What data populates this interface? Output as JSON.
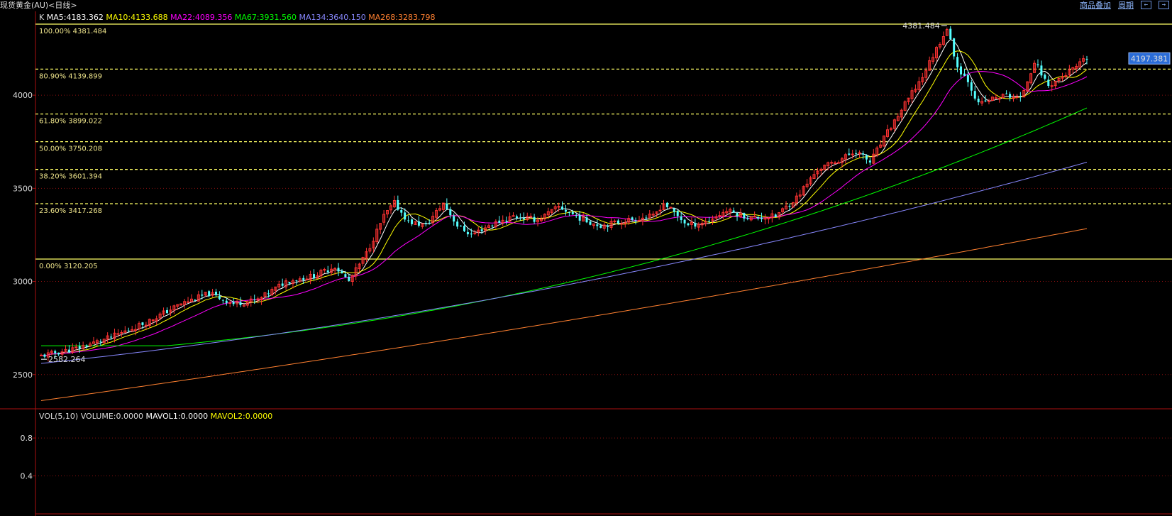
{
  "window": {
    "title": "现货黄金(AU)<日线>",
    "links": [
      "商品叠加",
      "周期"
    ],
    "nav_buttons": [
      "←",
      "→"
    ]
  },
  "indicator_legend": {
    "prefix": "K",
    "items": [
      {
        "text": "MA5:4183.362",
        "color": "#ffffff"
      },
      {
        "text": "MA10:4133.688",
        "color": "#ffff00"
      },
      {
        "text": "MA22:4089.356",
        "color": "#ff00ff"
      },
      {
        "text": "MA67:3931.560",
        "color": "#00ff00"
      },
      {
        "text": "MA134:3640.150",
        "color": "#8888ff"
      },
      {
        "text": "MA268:3283.798",
        "color": "#ff8030"
      }
    ]
  },
  "volume_legend": {
    "items": [
      {
        "text": "VOL(5,10)",
        "color": "#dddddd"
      },
      {
        "text": "VOLUME:0.0000",
        "color": "#dddddd"
      },
      {
        "text": "MAVOL1:0.0000",
        "color": "#ffffff"
      },
      {
        "text": "MAVOL2:0.0000",
        "color": "#ffff00"
      }
    ]
  },
  "chart_data": {
    "type": "candlestick",
    "title": "现货黄金(AU)<日线>",
    "ylim": [
      2320,
      4450
    ],
    "y_ticks": [
      "2500",
      "3000",
      "3500",
      "4000"
    ],
    "y_tick_values": [
      2500,
      3000,
      3500,
      4000
    ],
    "volume_ylim": [
      0,
      1.1
    ],
    "volume_ticks": [
      "0.4",
      "0.8"
    ],
    "volume_tick_values": [
      0.4,
      0.8
    ],
    "last_price_label": "4197.381",
    "last_price": 4197.381,
    "high_label": "4381.484",
    "high": 4381.484,
    "low_label": "2582.264",
    "low": 2582.264,
    "fibonacci_levels": [
      {
        "label": "100.00% 4381.484",
        "value": 4381.484,
        "style": "solid"
      },
      {
        "label": "80.90% 4139.899",
        "value": 4139.899,
        "style": "dashed"
      },
      {
        "label": "61.80% 3899.022",
        "value": 3899.022,
        "style": "dashed"
      },
      {
        "label": "50.00% 3750.208",
        "value": 3750.208,
        "style": "dashed"
      },
      {
        "label": "38.20% 3601.394",
        "value": 3601.394,
        "style": "dashed"
      },
      {
        "label": "23.60% 3417.268",
        "value": 3417.268,
        "style": "dashed"
      },
      {
        "label": "0.00% 3120.205",
        "value": 3120.205,
        "style": "solid"
      }
    ],
    "close_path": [
      [
        0,
        2600
      ],
      [
        10,
        2640
      ],
      [
        20,
        2700
      ],
      [
        30,
        2780
      ],
      [
        40,
        2880
      ],
      [
        48,
        2935
      ],
      [
        55,
        2880
      ],
      [
        62,
        2900
      ],
      [
        70,
        3000
      ],
      [
        78,
        3030
      ],
      [
        84,
        3080
      ],
      [
        88,
        3000
      ],
      [
        93,
        3150
      ],
      [
        98,
        3350
      ],
      [
        101,
        3420
      ],
      [
        105,
        3320
      ],
      [
        110,
        3300
      ],
      [
        115,
        3420
      ],
      [
        119,
        3300
      ],
      [
        123,
        3250
      ],
      [
        128,
        3300
      ],
      [
        135,
        3350
      ],
      [
        142,
        3330
      ],
      [
        148,
        3400
      ],
      [
        155,
        3330
      ],
      [
        160,
        3300
      ],
      [
        168,
        3330
      ],
      [
        175,
        3350
      ],
      [
        178,
        3420
      ],
      [
        185,
        3300
      ],
      [
        190,
        3320
      ],
      [
        196,
        3380
      ],
      [
        203,
        3340
      ],
      [
        210,
        3350
      ],
      [
        216,
        3450
      ],
      [
        222,
        3600
      ],
      [
        228,
        3650
      ],
      [
        233,
        3700
      ],
      [
        237,
        3640
      ],
      [
        242,
        3800
      ],
      [
        247,
        3950
      ],
      [
        252,
        4100
      ],
      [
        256,
        4250
      ],
      [
        259,
        4360
      ],
      [
        262,
        4150
      ],
      [
        265,
        4080
      ],
      [
        268,
        3950
      ],
      [
        272,
        3980
      ],
      [
        276,
        4000
      ],
      [
        280,
        3980
      ],
      [
        284,
        4180
      ],
      [
        288,
        4050
      ],
      [
        292,
        4100
      ],
      [
        296,
        4150
      ],
      [
        299,
        4197.381
      ]
    ],
    "ma_end_values": {
      "MA5": 4183.362,
      "MA10": 4133.688,
      "MA22": 4089.356,
      "MA67": 3931.56,
      "MA134": 3640.15,
      "MA268": 3283.798
    },
    "ma_start_values": {
      "MA67": 2655,
      "MA134": 2560,
      "MA268": 2360
    },
    "colors": {
      "up": "#ff3333",
      "down": "#55ffff",
      "grid": "#8a1010",
      "axis": "#aa1010",
      "fib": "#ffff66",
      "price_tag_bg": "#2a6cd8"
    }
  }
}
